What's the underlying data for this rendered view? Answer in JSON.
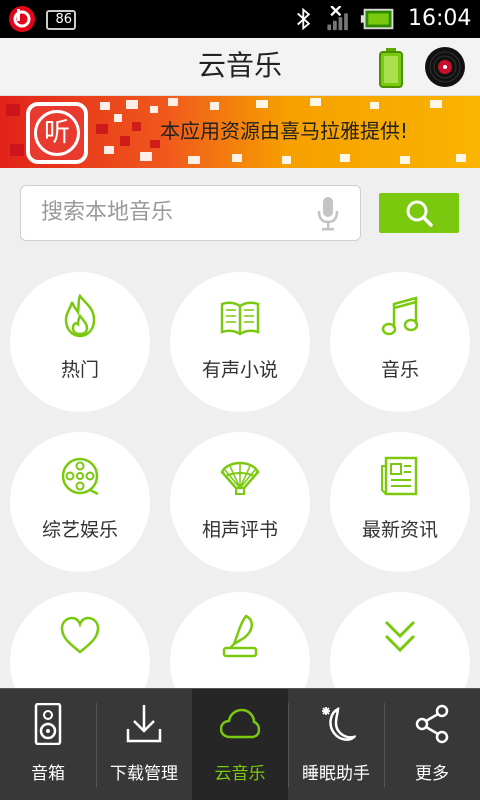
{
  "status_bar": {
    "badge_count": "86",
    "time": "16:04"
  },
  "header": {
    "title": "云音乐",
    "icons": [
      "battery-saver-icon",
      "vinyl-record-icon"
    ]
  },
  "banner": {
    "app_icon_glyph": "听",
    "text": "本应用资源由喜马拉雅提供!"
  },
  "search": {
    "placeholder": "搜索本地音乐",
    "icons": [
      "microphone-icon",
      "search-icon"
    ]
  },
  "categories": [
    {
      "label": "热门",
      "icon": "fire-icon"
    },
    {
      "label": "有声小说",
      "icon": "open-book-icon"
    },
    {
      "label": "音乐",
      "icon": "music-note-icon"
    },
    {
      "label": "综艺娱乐",
      "icon": "film-reel-icon"
    },
    {
      "label": "相声评书",
      "icon": "folding-fan-icon"
    },
    {
      "label": "最新资讯",
      "icon": "newspaper-icon"
    },
    {
      "label": "",
      "icon": "heart-icon"
    },
    {
      "label": "",
      "icon": "quill-books-icon"
    },
    {
      "label": "",
      "icon": "double-chevron-down-icon"
    }
  ],
  "bottom_nav": [
    {
      "label": "音箱",
      "icon": "speaker-icon"
    },
    {
      "label": "下载管理",
      "icon": "download-icon"
    },
    {
      "label": "云音乐",
      "icon": "cloud-icon",
      "active": true
    },
    {
      "label": "睡眠助手",
      "icon": "moon-star-icon"
    },
    {
      "label": "更多",
      "icon": "share-icon"
    }
  ],
  "colors": {
    "accent": "#7ac90e",
    "banner": "#f7a000",
    "app_icon": "#e83a2f",
    "nav_bg": "#383838"
  }
}
